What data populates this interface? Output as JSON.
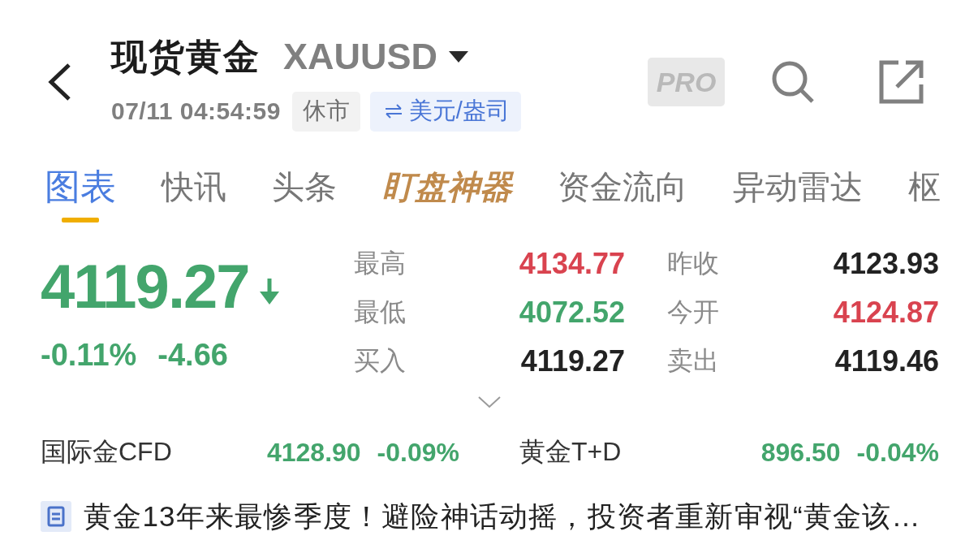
{
  "header": {
    "title": "现货黄金",
    "symbol": "XAUUSD",
    "timestamp": "07/11 04:54:59",
    "market_status": "休市",
    "unit": "美元/盎司",
    "pro_badge": "PRO"
  },
  "tabs": [
    {
      "label": "图表",
      "selected": true,
      "kind": "plain"
    },
    {
      "label": "快讯",
      "selected": false,
      "kind": "plain"
    },
    {
      "label": "头条",
      "selected": false,
      "kind": "plain"
    },
    {
      "label": "盯盘神器",
      "selected": false,
      "kind": "featured"
    },
    {
      "label": "资金流向",
      "selected": false,
      "kind": "plain"
    },
    {
      "label": "异动雷达",
      "selected": false,
      "kind": "plain"
    },
    {
      "label": "枢",
      "selected": false,
      "kind": "plain"
    }
  ],
  "quote": {
    "price": "4119.27",
    "falling": true,
    "change_percent": "-0.11%",
    "change": "-4.66"
  },
  "stats": [
    {
      "label": "最高",
      "value": "4134.77",
      "color": "#d9434f"
    },
    {
      "label": "昨收",
      "value": "4123.93",
      "color": "#222222"
    },
    {
      "label": "最低",
      "value": "4072.52",
      "color": "#43a56c"
    },
    {
      "label": "今开",
      "value": "4124.87",
      "color": "#d9434f"
    },
    {
      "label": "买入",
      "value": "4119.27",
      "color": "#222222"
    },
    {
      "label": "卖出",
      "value": "4119.46",
      "color": "#222222"
    }
  ],
  "related": [
    {
      "name": "国际金CFD",
      "price": "4128.90",
      "change": "-0.09%",
      "falling": true
    },
    {
      "name": "黄金T+D",
      "price": "896.50",
      "change": "-0.04%",
      "falling": true
    }
  ],
  "news": {
    "headline": "黄金13年来最惨季度！避险神话动摇，投资者重新审视“黄金该…"
  }
}
